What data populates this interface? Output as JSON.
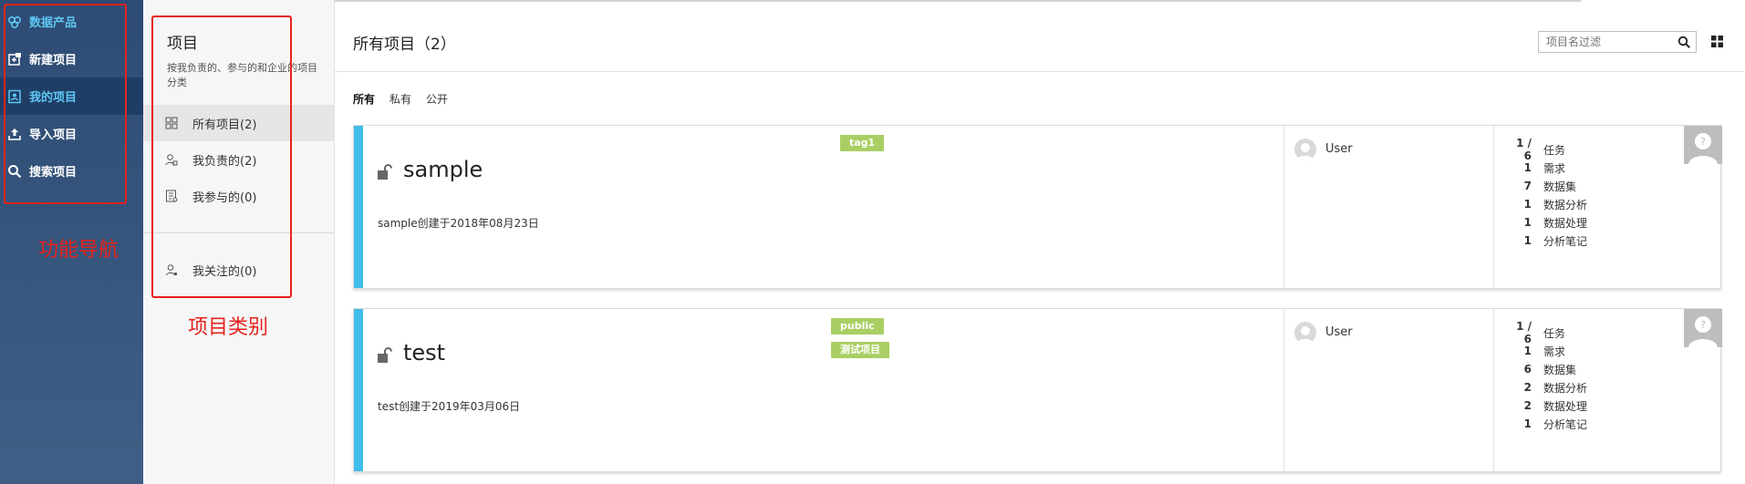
{
  "nav": {
    "items": [
      {
        "label": "数据产品",
        "icon": "data-product-icon"
      },
      {
        "label": "新建项目",
        "icon": "new-project-icon"
      },
      {
        "label": "我的项目",
        "icon": "my-project-icon"
      },
      {
        "label": "导入项目",
        "icon": "upload-icon"
      },
      {
        "label": "搜索项目",
        "icon": "search-icon"
      }
    ],
    "annotation": "功能导航"
  },
  "category": {
    "title": "项目",
    "desc": "按我负责的、参与的和企业的项目分类",
    "items": [
      {
        "label": "所有项目(2)",
        "icon": "grid-icon"
      },
      {
        "label": "我负责的(2)",
        "icon": "user-owner-icon"
      },
      {
        "label": "我参与的(0)",
        "icon": "participate-icon"
      },
      {
        "label": "我关注的(0)",
        "icon": "follow-icon"
      }
    ],
    "annotation": "项目类别"
  },
  "main": {
    "title": "所有项目（2）",
    "search_placeholder": "项目名过滤",
    "filters": [
      "所有",
      "私有",
      "公开"
    ],
    "active_filter": "所有"
  },
  "projects": [
    {
      "name": "sample",
      "desc": "sample创建于2018年08月23日",
      "tags": [
        "tag1"
      ],
      "user": "User",
      "stats": [
        {
          "n": "1 / 6",
          "label": "任务"
        },
        {
          "n": "1",
          "label": "需求"
        },
        {
          "n": "7",
          "label": "数据集"
        },
        {
          "n": "1",
          "label": "数据分析"
        },
        {
          "n": "1",
          "label": "数据处理"
        },
        {
          "n": "1",
          "label": "分析笔记"
        }
      ]
    },
    {
      "name": "test",
      "desc": "test创建于2019年03月06日",
      "tags": [
        "public",
        "测试项目"
      ],
      "user": "User",
      "stats": [
        {
          "n": "1 / 6",
          "label": "任务"
        },
        {
          "n": "1",
          "label": "需求"
        },
        {
          "n": "6",
          "label": "数据集"
        },
        {
          "n": "2",
          "label": "数据分析"
        },
        {
          "n": "2",
          "label": "数据处理"
        },
        {
          "n": "1",
          "label": "分析笔记"
        }
      ]
    }
  ],
  "colors": {
    "nav_bg": "#2d4b74",
    "nav_active": "#5fc6f2",
    "accent": "#3fbde8",
    "tag": "#a9cf64",
    "annotation": "#e8221b"
  }
}
